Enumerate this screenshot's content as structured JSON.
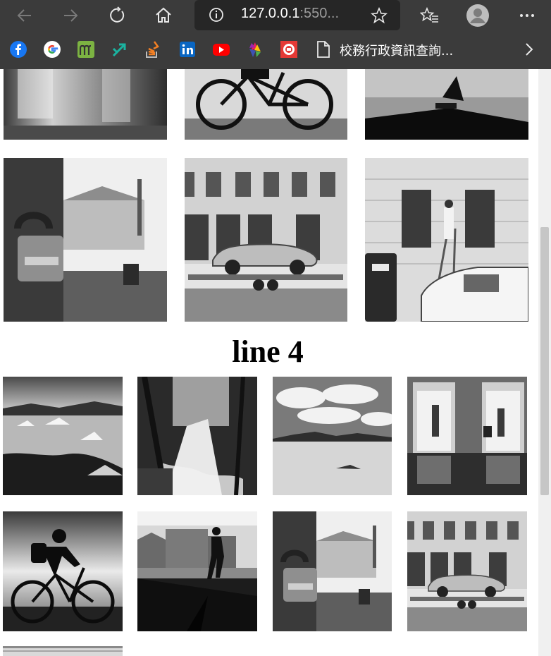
{
  "browser": {
    "url_host": "127.0.0.1",
    "url_port": ":550...",
    "bookmark_label": "校務行政資訊查詢..."
  },
  "page": {
    "heading": "line 4"
  },
  "icons": {
    "back": "arrow-left-icon",
    "forward": "arrow-right-icon",
    "refresh": "refresh-icon",
    "home": "home-icon",
    "info": "info-icon",
    "favorite": "star-icon",
    "favorites_list": "favorites-icon",
    "profile": "profile-icon",
    "more": "more-icon",
    "chevron": "chevron-right-icon"
  },
  "bookmarks": [
    {
      "name": "facebook",
      "color": "#1877f2"
    },
    {
      "name": "google",
      "color": "#ffffff"
    },
    {
      "name": "moodle",
      "color": "#7cb342"
    },
    {
      "name": "arrow-link",
      "color": "#1bb3a0"
    },
    {
      "name": "stack-overflow",
      "color": "#f48024"
    },
    {
      "name": "linkedin",
      "color": "#0a66c2"
    },
    {
      "name": "youtube",
      "color": "#ff0000"
    },
    {
      "name": "colorful",
      "color": "#e91e63"
    },
    {
      "name": "badge",
      "color": "#e53935"
    }
  ]
}
